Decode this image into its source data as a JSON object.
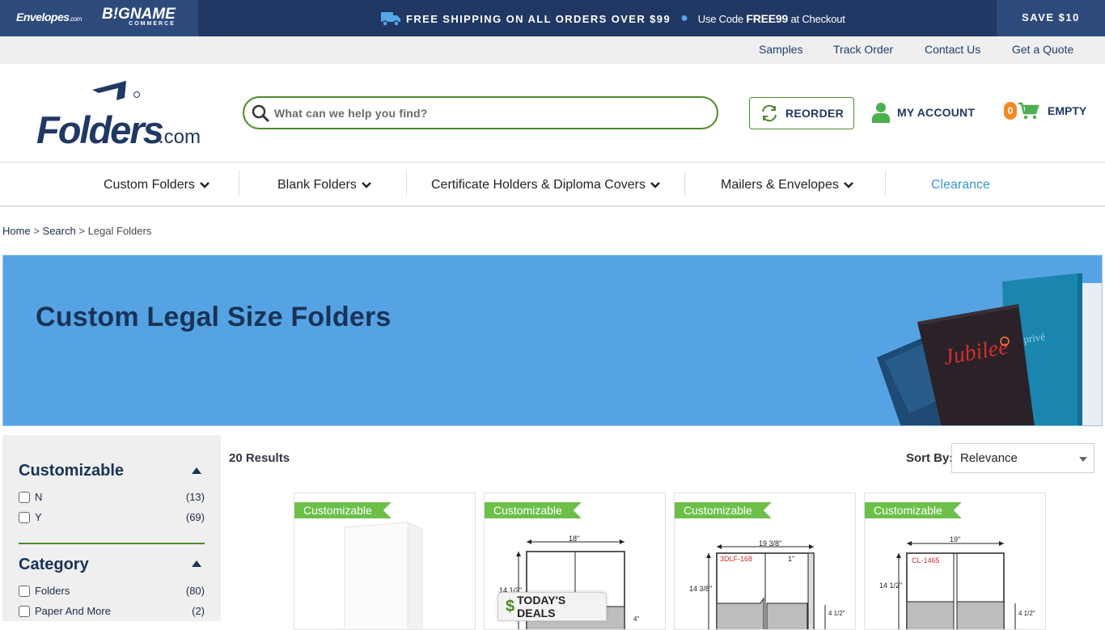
{
  "topbar": {
    "brand1": "Envelopes",
    "brand1_suffix": ".com",
    "brand2": "B!GNAME",
    "brand2_sub": "COMMERCE",
    "shipping": "FREE SHIPPING ON ALL ORDERS OVER $99",
    "code_prefix": "Use Code ",
    "code": "FREE99",
    "code_suffix": " at Checkout",
    "save": "SAVE $10"
  },
  "utility": {
    "samples": "Samples",
    "track": "Track Order",
    "contact": "Contact Us",
    "quote": "Get a Quote"
  },
  "header": {
    "logo_text": "Folders",
    "logo_suffix": ".com",
    "search_placeholder": "What can we help you find?",
    "reorder": "REORDER",
    "account": "MY ACCOUNT",
    "cart_count": "0",
    "cart_label": "EMPTY",
    "accent_green": "#4c8a2c",
    "navy": "#203863"
  },
  "nav": {
    "custom": "Custom Folders",
    "blank": "Blank Folders",
    "certificate": "Certificate Holders & Diploma Covers",
    "mailers": "Mailers & Envelopes",
    "clearance": "Clearance"
  },
  "breadcrumb": {
    "home": "Home",
    "search": "Search",
    "current": "Legal Folders",
    "sep": ">"
  },
  "hero": {
    "title": "Custom Legal Size Folders",
    "folder_brand": "Jubilee",
    "folder_brand2": "privé"
  },
  "sidebar": {
    "facets": [
      {
        "title": "Customizable",
        "options": [
          {
            "label": "N",
            "count": "(13)"
          },
          {
            "label": "Y",
            "count": "(69)"
          }
        ]
      },
      {
        "title": "Category",
        "options": [
          {
            "label": "Folders",
            "count": "(80)"
          },
          {
            "label": "Paper And More",
            "count": "(2)"
          }
        ]
      }
    ]
  },
  "results": {
    "count": "20 Results",
    "sort_label": "Sort By:",
    "sort_value": "Relevance"
  },
  "products": [
    {
      "badge": "Customizable"
    },
    {
      "badge": "Customizable",
      "dim_w": "18\"",
      "dim_h": "14 1/2\"",
      "pocket": "4\""
    },
    {
      "badge": "Customizable",
      "dim_w": "19 3/8\"",
      "dim_h": "14 3/8\"",
      "code": "3DLF-168",
      "flap": "1\"",
      "pocket": "4 1/2\""
    },
    {
      "badge": "Customizable",
      "dim_w": "19\"",
      "dim_h": "14 1/2\"",
      "code": "CL-1465",
      "pocket": "4 1/2\""
    }
  ],
  "deals": {
    "label": "TODAY'S DEALS",
    "symbol": "$"
  }
}
